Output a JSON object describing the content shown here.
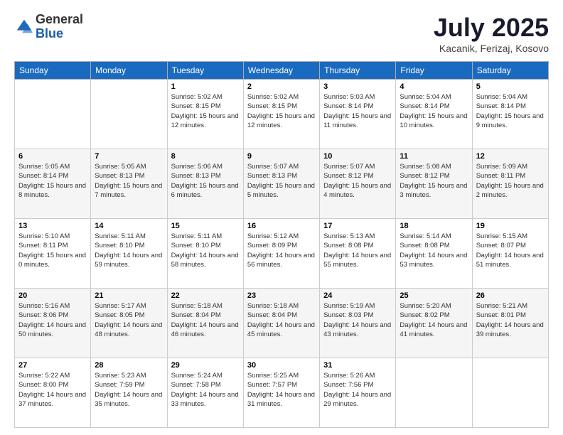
{
  "logo": {
    "general": "General",
    "blue": "Blue"
  },
  "title": "July 2025",
  "location": "Kacanik, Ferizaj, Kosovo",
  "days_of_week": [
    "Sunday",
    "Monday",
    "Tuesday",
    "Wednesday",
    "Thursday",
    "Friday",
    "Saturday"
  ],
  "weeks": [
    [
      {
        "day": "",
        "info": ""
      },
      {
        "day": "",
        "info": ""
      },
      {
        "day": "1",
        "info": "Sunrise: 5:02 AM\nSunset: 8:15 PM\nDaylight: 15 hours and 12 minutes."
      },
      {
        "day": "2",
        "info": "Sunrise: 5:02 AM\nSunset: 8:15 PM\nDaylight: 15 hours and 12 minutes."
      },
      {
        "day": "3",
        "info": "Sunrise: 5:03 AM\nSunset: 8:14 PM\nDaylight: 15 hours and 11 minutes."
      },
      {
        "day": "4",
        "info": "Sunrise: 5:04 AM\nSunset: 8:14 PM\nDaylight: 15 hours and 10 minutes."
      },
      {
        "day": "5",
        "info": "Sunrise: 5:04 AM\nSunset: 8:14 PM\nDaylight: 15 hours and 9 minutes."
      }
    ],
    [
      {
        "day": "6",
        "info": "Sunrise: 5:05 AM\nSunset: 8:14 PM\nDaylight: 15 hours and 8 minutes."
      },
      {
        "day": "7",
        "info": "Sunrise: 5:05 AM\nSunset: 8:13 PM\nDaylight: 15 hours and 7 minutes."
      },
      {
        "day": "8",
        "info": "Sunrise: 5:06 AM\nSunset: 8:13 PM\nDaylight: 15 hours and 6 minutes."
      },
      {
        "day": "9",
        "info": "Sunrise: 5:07 AM\nSunset: 8:13 PM\nDaylight: 15 hours and 5 minutes."
      },
      {
        "day": "10",
        "info": "Sunrise: 5:07 AM\nSunset: 8:12 PM\nDaylight: 15 hours and 4 minutes."
      },
      {
        "day": "11",
        "info": "Sunrise: 5:08 AM\nSunset: 8:12 PM\nDaylight: 15 hours and 3 minutes."
      },
      {
        "day": "12",
        "info": "Sunrise: 5:09 AM\nSunset: 8:11 PM\nDaylight: 15 hours and 2 minutes."
      }
    ],
    [
      {
        "day": "13",
        "info": "Sunrise: 5:10 AM\nSunset: 8:11 PM\nDaylight: 15 hours and 0 minutes."
      },
      {
        "day": "14",
        "info": "Sunrise: 5:11 AM\nSunset: 8:10 PM\nDaylight: 14 hours and 59 minutes."
      },
      {
        "day": "15",
        "info": "Sunrise: 5:11 AM\nSunset: 8:10 PM\nDaylight: 14 hours and 58 minutes."
      },
      {
        "day": "16",
        "info": "Sunrise: 5:12 AM\nSunset: 8:09 PM\nDaylight: 14 hours and 56 minutes."
      },
      {
        "day": "17",
        "info": "Sunrise: 5:13 AM\nSunset: 8:08 PM\nDaylight: 14 hours and 55 minutes."
      },
      {
        "day": "18",
        "info": "Sunrise: 5:14 AM\nSunset: 8:08 PM\nDaylight: 14 hours and 53 minutes."
      },
      {
        "day": "19",
        "info": "Sunrise: 5:15 AM\nSunset: 8:07 PM\nDaylight: 14 hours and 51 minutes."
      }
    ],
    [
      {
        "day": "20",
        "info": "Sunrise: 5:16 AM\nSunset: 8:06 PM\nDaylight: 14 hours and 50 minutes."
      },
      {
        "day": "21",
        "info": "Sunrise: 5:17 AM\nSunset: 8:05 PM\nDaylight: 14 hours and 48 minutes."
      },
      {
        "day": "22",
        "info": "Sunrise: 5:18 AM\nSunset: 8:04 PM\nDaylight: 14 hours and 46 minutes."
      },
      {
        "day": "23",
        "info": "Sunrise: 5:18 AM\nSunset: 8:04 PM\nDaylight: 14 hours and 45 minutes."
      },
      {
        "day": "24",
        "info": "Sunrise: 5:19 AM\nSunset: 8:03 PM\nDaylight: 14 hours and 43 minutes."
      },
      {
        "day": "25",
        "info": "Sunrise: 5:20 AM\nSunset: 8:02 PM\nDaylight: 14 hours and 41 minutes."
      },
      {
        "day": "26",
        "info": "Sunrise: 5:21 AM\nSunset: 8:01 PM\nDaylight: 14 hours and 39 minutes."
      }
    ],
    [
      {
        "day": "27",
        "info": "Sunrise: 5:22 AM\nSunset: 8:00 PM\nDaylight: 14 hours and 37 minutes."
      },
      {
        "day": "28",
        "info": "Sunrise: 5:23 AM\nSunset: 7:59 PM\nDaylight: 14 hours and 35 minutes."
      },
      {
        "day": "29",
        "info": "Sunrise: 5:24 AM\nSunset: 7:58 PM\nDaylight: 14 hours and 33 minutes."
      },
      {
        "day": "30",
        "info": "Sunrise: 5:25 AM\nSunset: 7:57 PM\nDaylight: 14 hours and 31 minutes."
      },
      {
        "day": "31",
        "info": "Sunrise: 5:26 AM\nSunset: 7:56 PM\nDaylight: 14 hours and 29 minutes."
      },
      {
        "day": "",
        "info": ""
      },
      {
        "day": "",
        "info": ""
      }
    ]
  ]
}
